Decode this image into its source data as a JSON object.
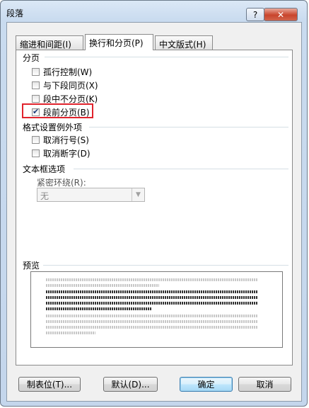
{
  "window": {
    "title": "段落",
    "help": "?",
    "close": "✕"
  },
  "tabs": [
    {
      "label": "缩进和间距(I)",
      "active": false
    },
    {
      "label": "换行和分页(P)",
      "active": true
    },
    {
      "label": "中文版式(H)",
      "active": false
    }
  ],
  "pagination": {
    "title": "分页",
    "items": [
      {
        "label": "孤行控制(W)",
        "checked": false
      },
      {
        "label": "与下段同页(X)",
        "checked": false
      },
      {
        "label": "段中不分页(K)",
        "checked": false
      },
      {
        "label": "段前分页(B)",
        "checked": true
      }
    ]
  },
  "exceptions": {
    "title": "格式设置例外项",
    "items": [
      {
        "label": "取消行号(S)",
        "checked": false
      },
      {
        "label": "取消断字(D)",
        "checked": false
      }
    ]
  },
  "textbox": {
    "title": "文本框选项",
    "wrap_label": "紧密环绕(R):",
    "wrap_value": "无"
  },
  "preview": {
    "title": "预览"
  },
  "buttons": {
    "tabs": "制表位(T)...",
    "default": "默认(D)...",
    "ok": "确定",
    "cancel": "取消"
  }
}
